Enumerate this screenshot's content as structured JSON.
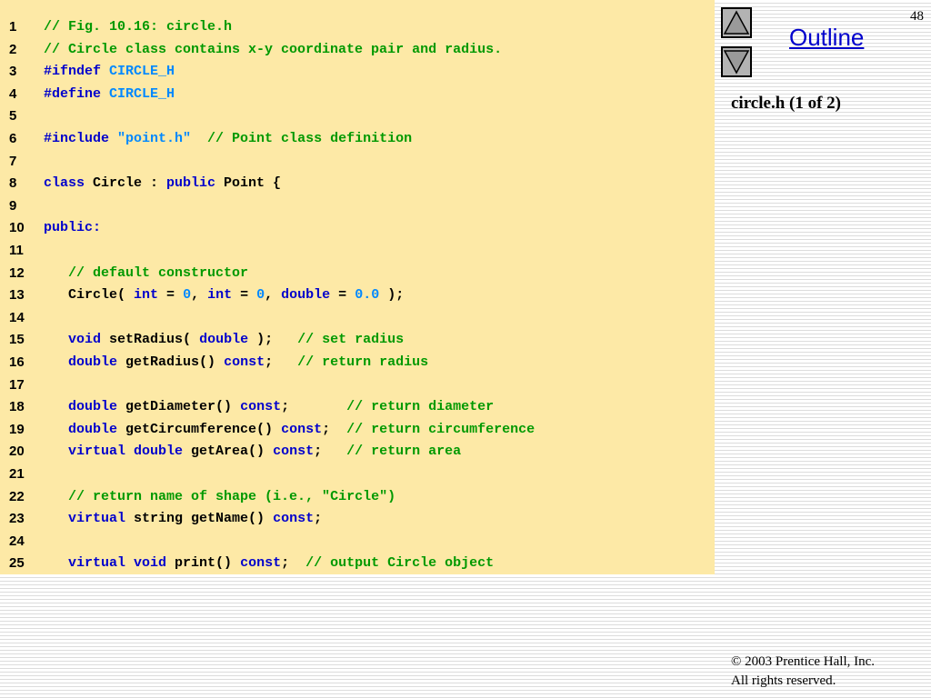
{
  "slide": {
    "number": "48",
    "outline_label": "Outline",
    "caption": "circle.h (1 of 2)",
    "footer_line1": "© 2003 Prentice Hall, Inc.",
    "footer_line2": "All rights reserved."
  },
  "nav": {
    "up_icon": "triangle-up-icon",
    "down_icon": "triangle-down-icon"
  },
  "colors": {
    "code_background": "#fde9a6",
    "comment": "#009900",
    "keyword": "#0000cc",
    "preprocessor_value": "#0088ff",
    "plain": "#000000",
    "link": "#0000cc"
  },
  "code_lines": [
    {
      "num": "1",
      "tokens": [
        {
          "t": "c",
          "v": "// Fig. 10.16: circle.h"
        }
      ]
    },
    {
      "num": "2",
      "tokens": [
        {
          "t": "c",
          "v": "// Circle class contains x-y coordinate pair and radius."
        }
      ]
    },
    {
      "num": "3",
      "tokens": [
        {
          "t": "k",
          "v": "#ifndef "
        },
        {
          "t": "p",
          "v": "CIRCLE_H"
        }
      ]
    },
    {
      "num": "4",
      "tokens": [
        {
          "t": "k",
          "v": "#define "
        },
        {
          "t": "p",
          "v": "CIRCLE_H"
        }
      ]
    },
    {
      "num": "5",
      "tokens": []
    },
    {
      "num": "6",
      "tokens": [
        {
          "t": "k",
          "v": "#include "
        },
        {
          "t": "p",
          "v": "\"point.h\""
        },
        {
          "t": "n",
          "v": "  "
        },
        {
          "t": "c",
          "v": "// Point class definition"
        }
      ]
    },
    {
      "num": "7",
      "tokens": []
    },
    {
      "num": "8",
      "tokens": [
        {
          "t": "k",
          "v": "class "
        },
        {
          "t": "n",
          "v": "Circle : "
        },
        {
          "t": "k",
          "v": "public "
        },
        {
          "t": "n",
          "v": "Point {"
        }
      ]
    },
    {
      "num": "9",
      "tokens": []
    },
    {
      "num": "10",
      "tokens": [
        {
          "t": "k",
          "v": "public:"
        }
      ]
    },
    {
      "num": "11",
      "tokens": []
    },
    {
      "num": "12",
      "tokens": [
        {
          "t": "n",
          "v": "   "
        },
        {
          "t": "c",
          "v": "// default constructor"
        }
      ]
    },
    {
      "num": "13",
      "tokens": [
        {
          "t": "n",
          "v": "   Circle( "
        },
        {
          "t": "k",
          "v": "int"
        },
        {
          "t": "n",
          "v": " = "
        },
        {
          "t": "l",
          "v": "0"
        },
        {
          "t": "n",
          "v": ", "
        },
        {
          "t": "k",
          "v": "int"
        },
        {
          "t": "n",
          "v": " = "
        },
        {
          "t": "l",
          "v": "0"
        },
        {
          "t": "n",
          "v": ", "
        },
        {
          "t": "k",
          "v": "double"
        },
        {
          "t": "n",
          "v": " = "
        },
        {
          "t": "l",
          "v": "0.0"
        },
        {
          "t": "n",
          "v": " );"
        }
      ]
    },
    {
      "num": "14",
      "tokens": []
    },
    {
      "num": "15",
      "tokens": [
        {
          "t": "n",
          "v": "   "
        },
        {
          "t": "k",
          "v": "void"
        },
        {
          "t": "n",
          "v": " setRadius( "
        },
        {
          "t": "k",
          "v": "double"
        },
        {
          "t": "n",
          "v": " );   "
        },
        {
          "t": "c",
          "v": "// set radius"
        }
      ]
    },
    {
      "num": "16",
      "tokens": [
        {
          "t": "n",
          "v": "   "
        },
        {
          "t": "k",
          "v": "double"
        },
        {
          "t": "n",
          "v": " getRadius() "
        },
        {
          "t": "k",
          "v": "const"
        },
        {
          "t": "n",
          "v": ";   "
        },
        {
          "t": "c",
          "v": "// return radius"
        }
      ]
    },
    {
      "num": "17",
      "tokens": []
    },
    {
      "num": "18",
      "tokens": [
        {
          "t": "n",
          "v": "   "
        },
        {
          "t": "k",
          "v": "double"
        },
        {
          "t": "n",
          "v": " getDiameter() "
        },
        {
          "t": "k",
          "v": "const"
        },
        {
          "t": "n",
          "v": ";       "
        },
        {
          "t": "c",
          "v": "// return diameter"
        }
      ]
    },
    {
      "num": "19",
      "tokens": [
        {
          "t": "n",
          "v": "   "
        },
        {
          "t": "k",
          "v": "double"
        },
        {
          "t": "n",
          "v": " getCircumference() "
        },
        {
          "t": "k",
          "v": "const"
        },
        {
          "t": "n",
          "v": ";  "
        },
        {
          "t": "c",
          "v": "// return circumference"
        }
      ]
    },
    {
      "num": "20",
      "tokens": [
        {
          "t": "n",
          "v": "   "
        },
        {
          "t": "k",
          "v": "virtual double"
        },
        {
          "t": "n",
          "v": " getArea() "
        },
        {
          "t": "k",
          "v": "const"
        },
        {
          "t": "n",
          "v": ";   "
        },
        {
          "t": "c",
          "v": "// return area"
        }
      ]
    },
    {
      "num": "21",
      "tokens": []
    },
    {
      "num": "22",
      "tokens": [
        {
          "t": "n",
          "v": "   "
        },
        {
          "t": "c",
          "v": "// return name of shape (i.e., \"Circle\")"
        }
      ]
    },
    {
      "num": "23",
      "tokens": [
        {
          "t": "n",
          "v": "   "
        },
        {
          "t": "k",
          "v": "virtual"
        },
        {
          "t": "n",
          "v": " string getName() "
        },
        {
          "t": "k",
          "v": "const"
        },
        {
          "t": "n",
          "v": ";"
        }
      ]
    },
    {
      "num": "24",
      "tokens": []
    },
    {
      "num": "25",
      "tokens": [
        {
          "t": "n",
          "v": "   "
        },
        {
          "t": "k",
          "v": "virtual void"
        },
        {
          "t": "n",
          "v": " print() "
        },
        {
          "t": "k",
          "v": "const"
        },
        {
          "t": "n",
          "v": ";  "
        },
        {
          "t": "c",
          "v": "// output Circle object"
        }
      ]
    }
  ]
}
